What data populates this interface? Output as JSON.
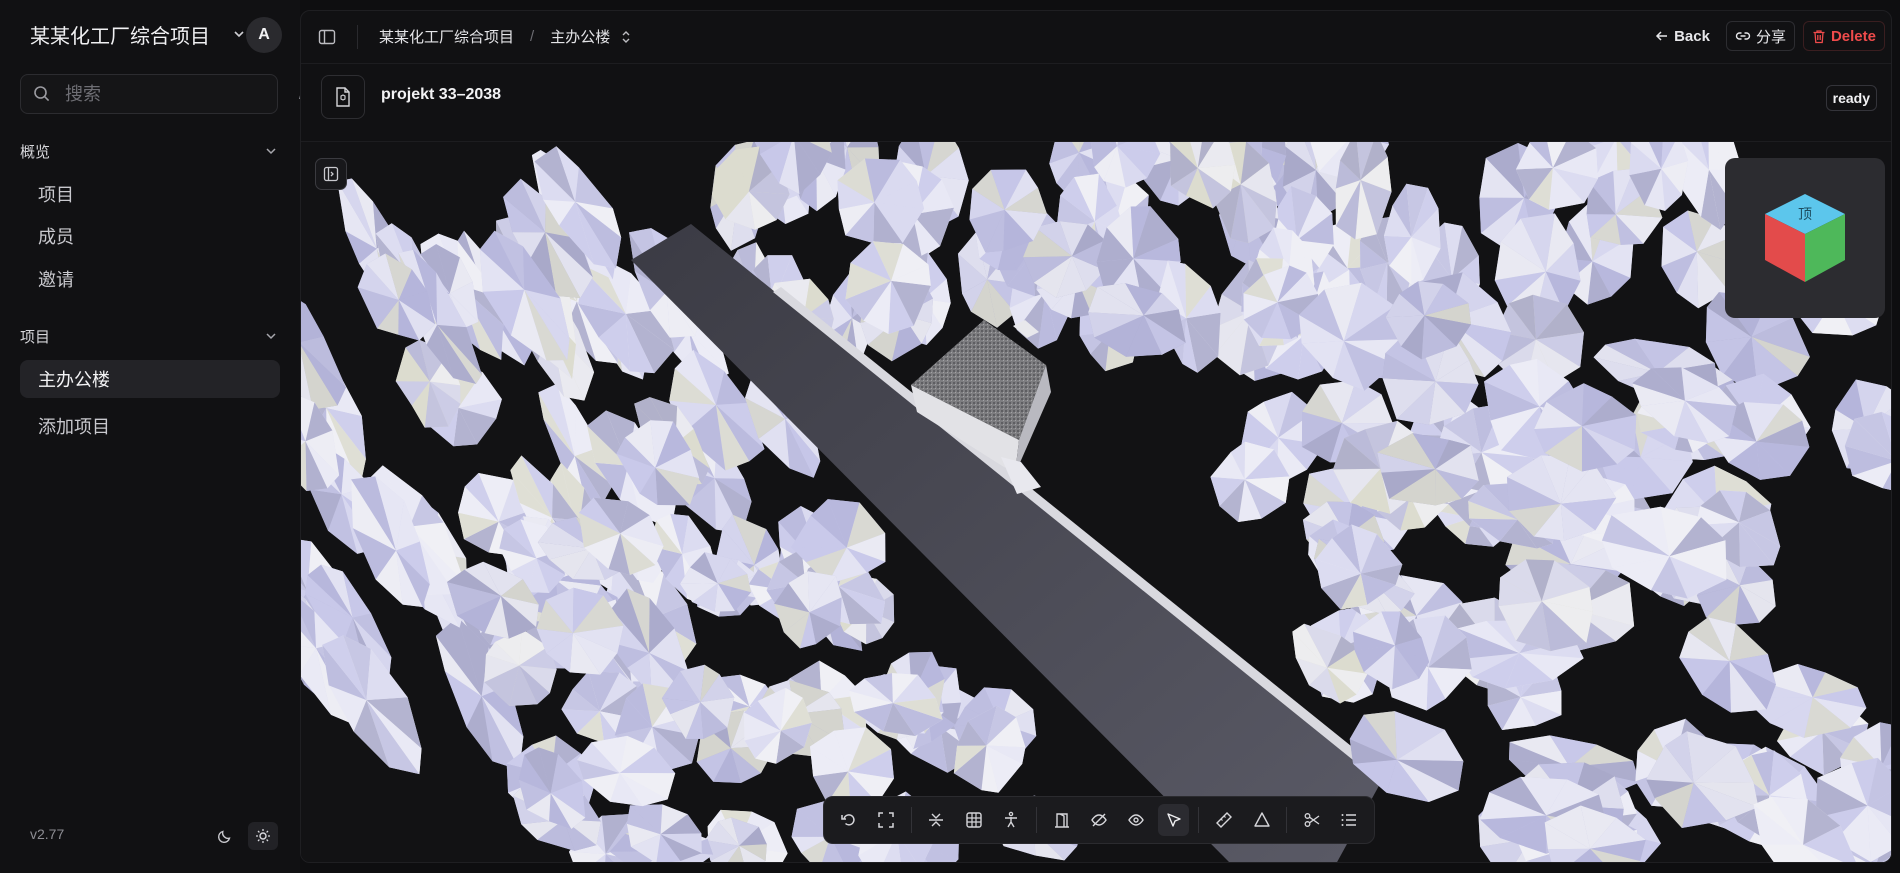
{
  "workspace": {
    "name": "某某化工厂综合项目",
    "avatar_initial": "A"
  },
  "search": {
    "placeholder": "搜索",
    "shortcut": "/"
  },
  "sections": {
    "overview": {
      "label": "概览",
      "items": [
        "项目",
        "成员",
        "邀请"
      ]
    },
    "projects": {
      "label": "项目",
      "items": [
        "主办公楼",
        "添加项目"
      ],
      "active": "主办公楼"
    }
  },
  "footer": {
    "version": "v2.77"
  },
  "breadcrumb": {
    "project": "某某化工厂综合项目",
    "separator": "/",
    "current": "主办公楼"
  },
  "actions": {
    "back": "Back",
    "share": "分享",
    "delete": "Delete"
  },
  "document": {
    "name": "projekt 33–2038",
    "status": "ready"
  },
  "viewer": {
    "navcube_faces": {
      "top": "顶"
    },
    "toolbar": [
      "undo-icon",
      "fullscreen-icon",
      "section-plane-icon",
      "grid-icon",
      "walk-person-icon",
      "door-icon",
      "hide-icon",
      "show-icon",
      "select-cursor-icon",
      "measure-ruler-icon",
      "area-triangle-icon",
      "cut-scissors-icon",
      "list-icon"
    ],
    "active_tool": "select-cursor-icon"
  },
  "colors": {
    "danger": "#ef4b4b",
    "background": "#111113",
    "tree_tint": "#d8d8ef",
    "road": "#4a4a55"
  }
}
